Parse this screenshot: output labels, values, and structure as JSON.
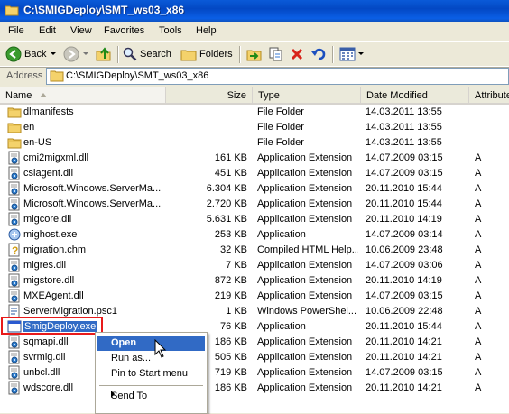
{
  "window": {
    "title": "C:\\SMIGDeploy\\SMT_ws03_x86"
  },
  "menu": [
    "File",
    "Edit",
    "View",
    "Favorites",
    "Tools",
    "Help"
  ],
  "toolbar": {
    "back_label": "Back",
    "search_label": "Search",
    "folders_label": "Folders"
  },
  "address": {
    "label": "Address",
    "value": "C:\\SMIGDeploy\\SMT_ws03_x86"
  },
  "columns": [
    "Name",
    "Size",
    "Type",
    "Date Modified",
    "Attributes"
  ],
  "files": [
    {
      "name": "dlmanifests",
      "size": "",
      "type": "File Folder",
      "date": "14.03.2011 13:55",
      "attr": "",
      "icon": "folder-icon"
    },
    {
      "name": "en",
      "size": "",
      "type": "File Folder",
      "date": "14.03.2011 13:55",
      "attr": "",
      "icon": "folder-icon"
    },
    {
      "name": "en-US",
      "size": "",
      "type": "File Folder",
      "date": "14.03.2011 13:55",
      "attr": "",
      "icon": "folder-icon"
    },
    {
      "name": "cmi2migxml.dll",
      "size": "161 KB",
      "type": "Application Extension",
      "date": "14.07.2009 03:15",
      "attr": "A",
      "icon": "dll-icon"
    },
    {
      "name": "csiagent.dll",
      "size": "451 KB",
      "type": "Application Extension",
      "date": "14.07.2009 03:15",
      "attr": "A",
      "icon": "dll-icon"
    },
    {
      "name": "Microsoft.Windows.ServerMa...",
      "size": "6.304 KB",
      "type": "Application Extension",
      "date": "20.11.2010 15:44",
      "attr": "A",
      "icon": "dll-icon"
    },
    {
      "name": "Microsoft.Windows.ServerMa...",
      "size": "2.720 KB",
      "type": "Application Extension",
      "date": "20.11.2010 15:44",
      "attr": "A",
      "icon": "dll-icon"
    },
    {
      "name": "migcore.dll",
      "size": "5.631 KB",
      "type": "Application Extension",
      "date": "20.11.2010 14:19",
      "attr": "A",
      "icon": "dll-icon"
    },
    {
      "name": "mighost.exe",
      "size": "253 KB",
      "type": "Application",
      "date": "14.07.2009 03:14",
      "attr": "A",
      "icon": "exe-icon"
    },
    {
      "name": "migration.chm",
      "size": "32 KB",
      "type": "Compiled HTML Help...",
      "date": "10.06.2009 23:48",
      "attr": "A",
      "icon": "help-icon"
    },
    {
      "name": "migres.dll",
      "size": "7 KB",
      "type": "Application Extension",
      "date": "14.07.2009 03:06",
      "attr": "A",
      "icon": "dll-icon"
    },
    {
      "name": "migstore.dll",
      "size": "872 KB",
      "type": "Application Extension",
      "date": "20.11.2010 14:19",
      "attr": "A",
      "icon": "dll-icon"
    },
    {
      "name": "MXEAgent.dll",
      "size": "219 KB",
      "type": "Application Extension",
      "date": "14.07.2009 03:15",
      "attr": "A",
      "icon": "dll-icon"
    },
    {
      "name": "ServerMigration.psc1",
      "size": "1 KB",
      "type": "Windows PowerShel...",
      "date": "10.06.2009 22:48",
      "attr": "A",
      "icon": "ps-icon"
    },
    {
      "name": "SmigDeploy.exe",
      "size": "76 KB",
      "type": "Application",
      "date": "20.11.2010 15:44",
      "attr": "A",
      "icon": "app-window-icon",
      "selected": true
    },
    {
      "name": "sqmapi.dll",
      "size": "186 KB",
      "type": "Application Extension",
      "date": "20.11.2010 14:21",
      "attr": "A",
      "icon": "dll-icon"
    },
    {
      "name": "svrmig.dll",
      "size": "505 KB",
      "type": "Application Extension",
      "date": "20.11.2010 14:21",
      "attr": "A",
      "icon": "dll-icon"
    },
    {
      "name": "unbcl.dll",
      "size": "719 KB",
      "type": "Application Extension",
      "date": "14.07.2009 03:15",
      "attr": "A",
      "icon": "dll-icon"
    },
    {
      "name": "wdscore.dll",
      "size": "186 KB",
      "type": "Application Extension",
      "date": "20.11.2010 14:21",
      "attr": "A",
      "icon": "dll-icon"
    }
  ],
  "context_menu": {
    "items": [
      "Open",
      "Run as...",
      "Pin to Start menu",
      "Send To"
    ]
  },
  "colors": {
    "titlebar": "#0348c4",
    "selection": "#316ac5",
    "highlight_box": "#e81a1a"
  }
}
